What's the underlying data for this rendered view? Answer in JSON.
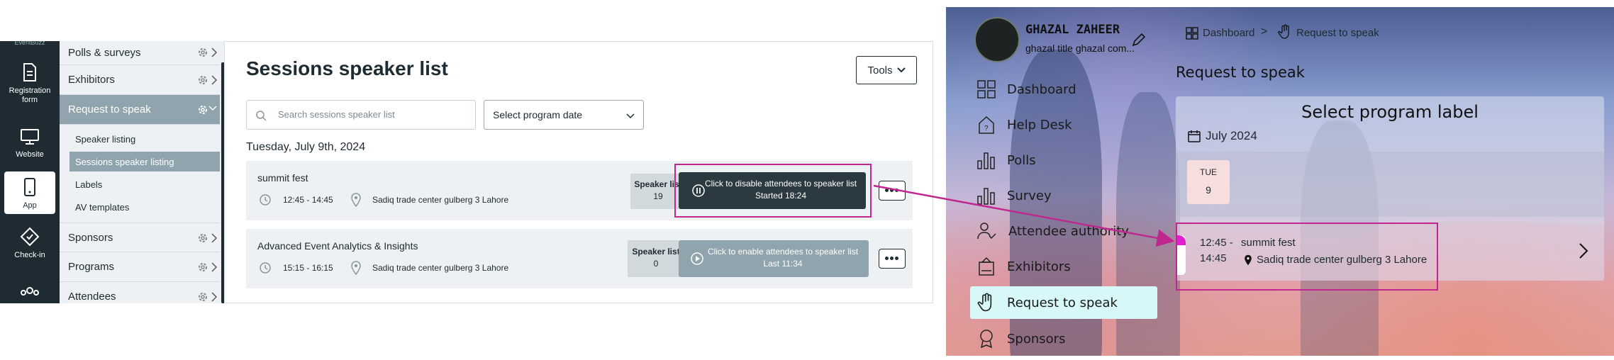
{
  "admin": {
    "rail": {
      "top_partial": "EventBuzz",
      "items": [
        {
          "label_line1": "Registration",
          "label_line2": "form",
          "icon": "form-icon"
        },
        {
          "label_line1": "Website",
          "label_line2": "",
          "icon": "monitor-icon"
        },
        {
          "label_line1": "App",
          "label_line2": "",
          "icon": "phone-icon"
        },
        {
          "label_line1": "Check-in",
          "label_line2": "",
          "icon": "ticket-icon"
        }
      ]
    },
    "menu": {
      "polls": "Polls & surveys",
      "exhibitors": "Exhibitors",
      "request_to_speak": "Request to speak",
      "sub_items": [
        "Speaker listing",
        "Sessions speaker listing",
        "Labels",
        "AV templates"
      ],
      "sponsors": "Sponsors",
      "programs": "Programs",
      "attendees": "Attendees"
    },
    "page": {
      "title": "Sessions speaker list",
      "tools_label": "Tools",
      "search_placeholder": "Search sessions speaker list",
      "date_select": "Select program date",
      "date_heading": "Tuesday, July 9th, 2024",
      "sessions": [
        {
          "name": "summit fest",
          "time": "12:45 - 14:45",
          "location": "Sadiq trade center gulberg 3 Lahore",
          "speaker_list_label": "Speaker list",
          "speaker_count": "19",
          "action_line1": "Click to disable attendees to speaker list",
          "action_line2": "Started 18:24",
          "action_state": "pause",
          "action_color": "#2b3a41"
        },
        {
          "name": "Advanced Event Analytics & Insights",
          "time": "15:15 - 16:15",
          "location": "Sadiq trade center gulberg 3 Lahore",
          "speaker_list_label": "Speaker list",
          "speaker_count": "0",
          "action_line1": "Click to enable attendees to speaker list",
          "action_line2": "Last 11:34",
          "action_state": "play",
          "action_color": "#8fa4ad"
        }
      ]
    }
  },
  "app": {
    "user_name": "GHAZAL ZAHEER",
    "user_subtitle": "ghazal title ghazal com...",
    "breadcrumb": {
      "home": "Dashboard",
      "separator": ">",
      "current": "Request to speak"
    },
    "sidebar": [
      {
        "label": "Dashboard",
        "icon": "grid-icon"
      },
      {
        "label": "Help Desk",
        "icon": "help-desk-icon"
      },
      {
        "label": "Polls",
        "icon": "bar-chart-icon"
      },
      {
        "label": "Survey",
        "icon": "bar-chart-icon"
      },
      {
        "label": "Attendee authority",
        "icon": "user-check-icon"
      },
      {
        "label": "Exhibitors",
        "icon": "booth-icon"
      },
      {
        "label": "Request to speak",
        "icon": "hand-icon",
        "active": true
      },
      {
        "label": "Sponsors",
        "icon": "badge-icon"
      }
    ],
    "page_title": "Request to speak",
    "panel_title": "Select program label",
    "month": "July 2024",
    "day_name": "TUE",
    "day_number": "9",
    "session": {
      "time_line1": "12:45 -",
      "time_line2": "14:45",
      "name": "summit fest",
      "location": "Sadiq trade center gulberg 3 Lahore"
    }
  },
  "colors": {
    "highlight": "#c0278f",
    "rail_bg": "#1e2b32",
    "active_side": "#d7f7f8"
  }
}
